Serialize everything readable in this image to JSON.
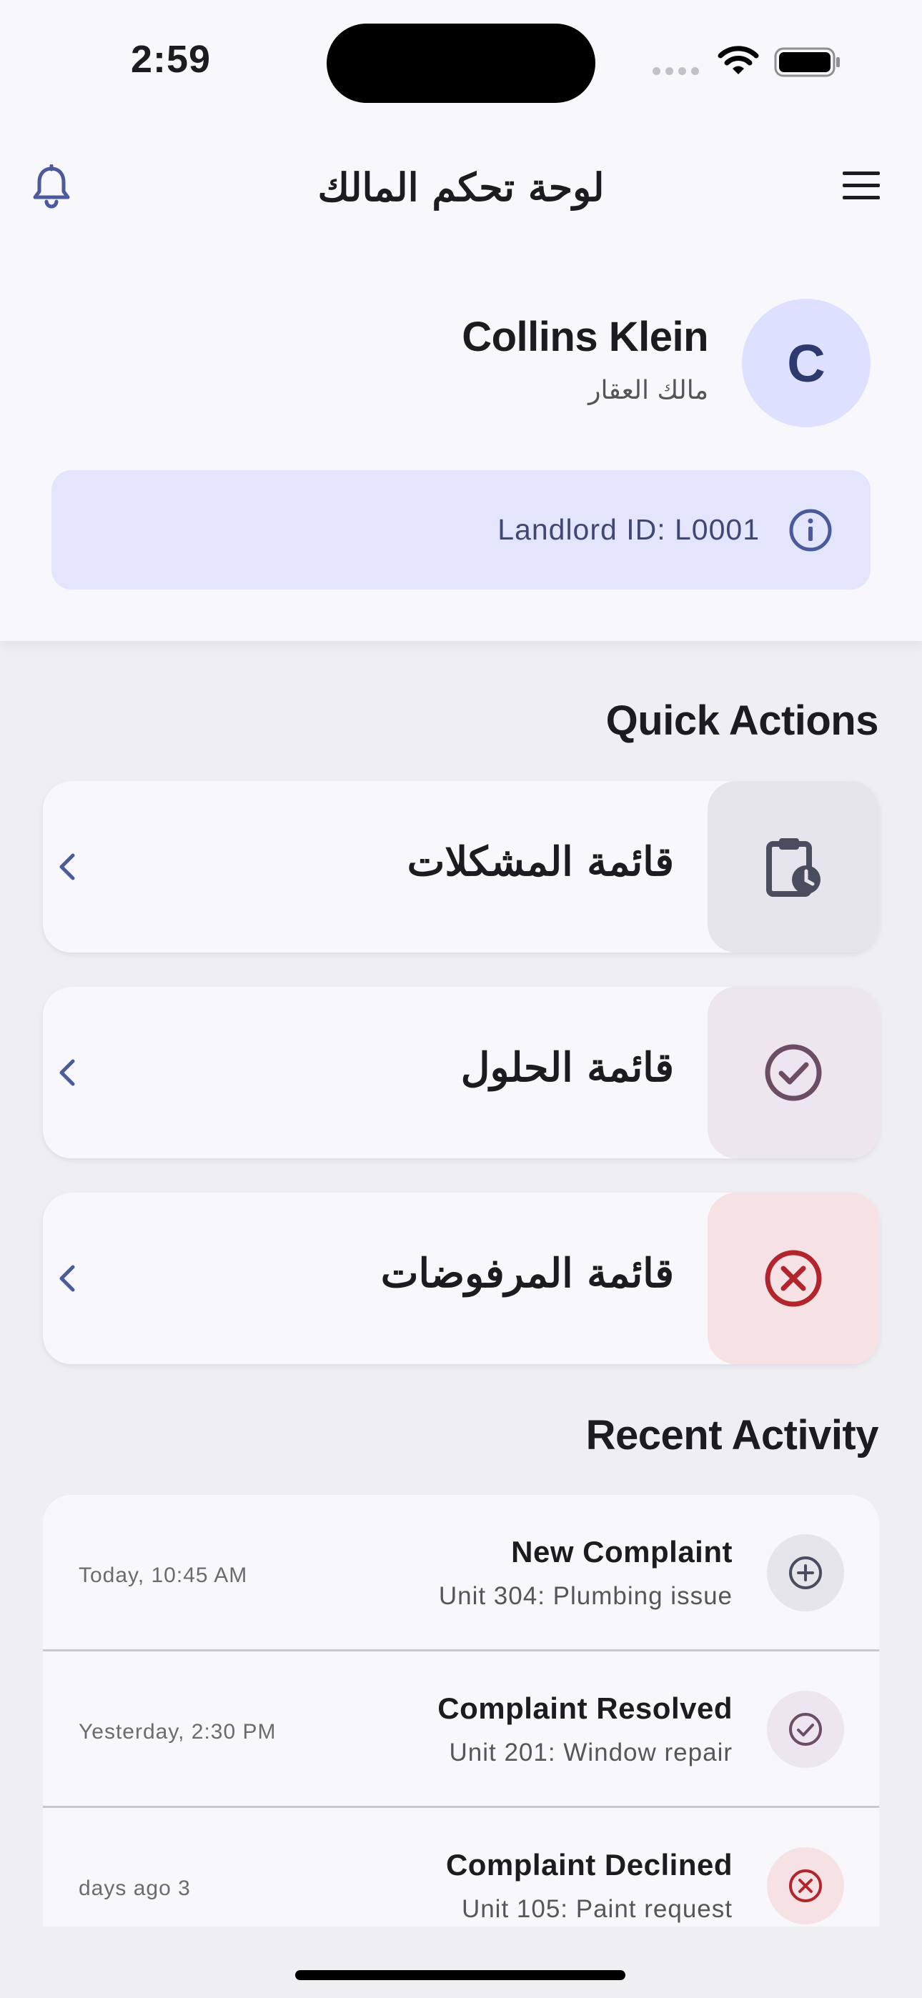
{
  "status_bar": {
    "time": "2:59"
  },
  "app_bar": {
    "title": "لوحة تحكم المالك",
    "icons": {
      "left": "bell-icon",
      "right": "menu-icon"
    }
  },
  "profile": {
    "name": "Collins Klein",
    "role": "مالك العقار",
    "avatar_initial": "C",
    "landlord_id_label": "Landlord ID: L0001",
    "info_icon": "info-icon"
  },
  "quick_actions": {
    "title": "Quick Actions",
    "items": [
      {
        "label": "قائمة المشكلات",
        "icon": "clipboard-clock-icon",
        "color": "#4a4d5e",
        "bg": "#e6e5ec"
      },
      {
        "label": "قائمة الحلول",
        "icon": "check-circle-icon",
        "color": "#6b4e64",
        "bg": "#ede6ef"
      },
      {
        "label": "قائمة المرفوضات",
        "icon": "x-circle-icon",
        "color": "#b3252d",
        "bg": "#f6e2e5"
      }
    ]
  },
  "recent_activity": {
    "title": "Recent Activity",
    "items": [
      {
        "title": "New Complaint",
        "subtitle": "Unit 304: Plumbing issue",
        "time": "Today, 10:45 AM",
        "icon": "plus-circle-icon"
      },
      {
        "title": "Complaint Resolved",
        "subtitle": "Unit 201: Window repair",
        "time": "Yesterday, 2:30 PM",
        "icon": "check-circle-icon"
      },
      {
        "title": "Complaint Declined",
        "subtitle": "Unit 105: Paint request",
        "time": "days ago 3",
        "icon": "x-circle-icon"
      }
    ]
  },
  "colors": {
    "accent": "#4a5a9a",
    "background": "#efeef3",
    "surface": "#f8f7fc",
    "id_card": "#e2e5fc",
    "avatar_bg": "#dde1ff",
    "decline": "#b3252d"
  }
}
